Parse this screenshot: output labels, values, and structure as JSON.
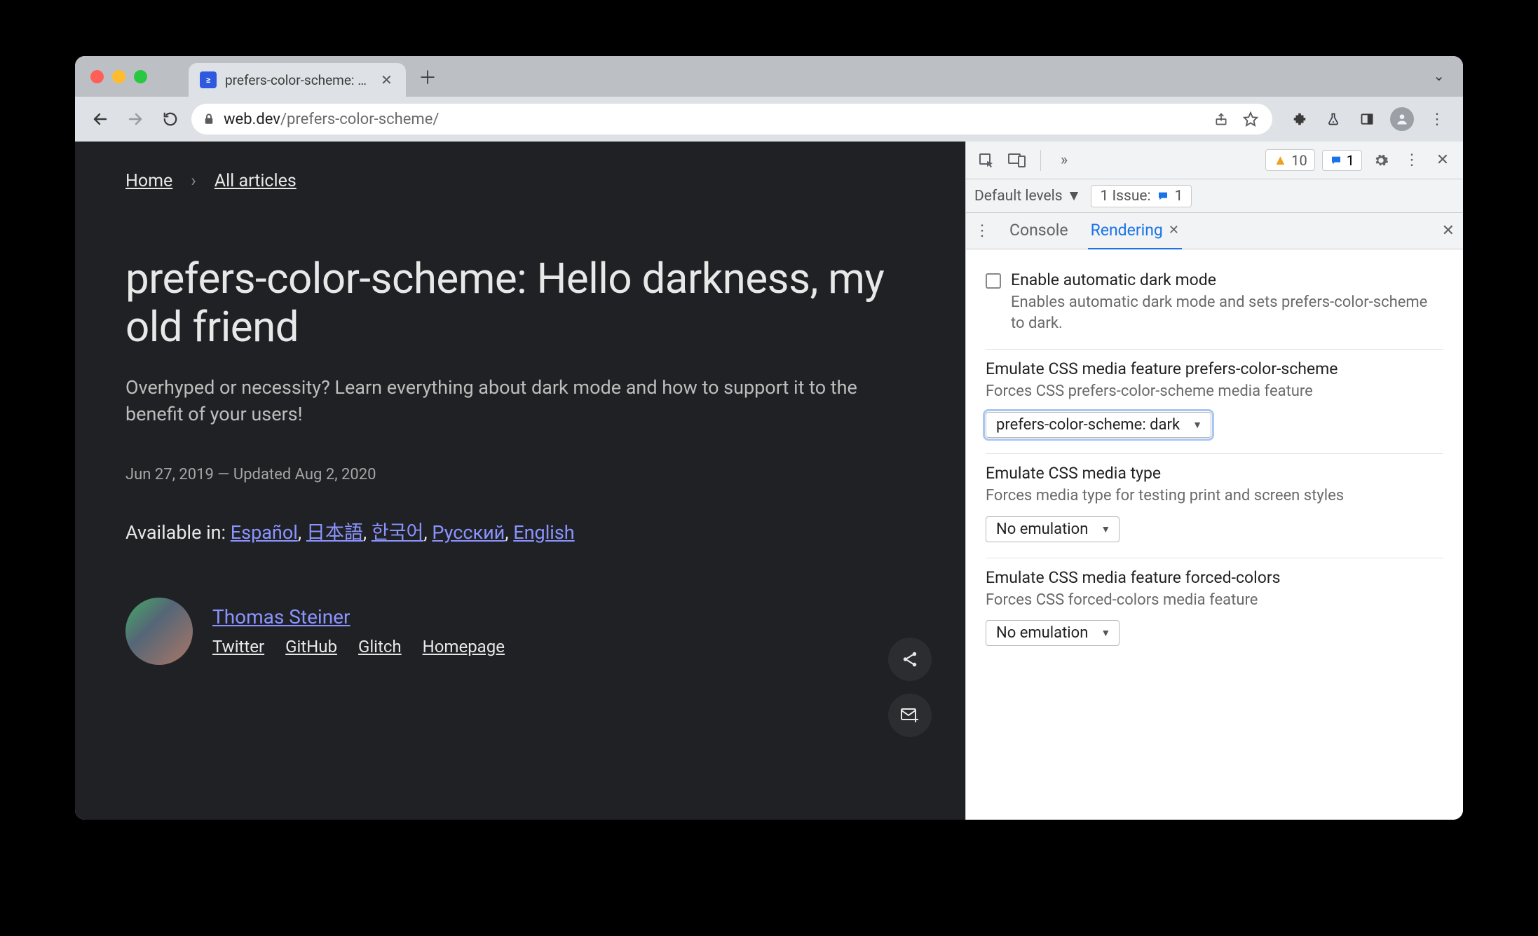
{
  "tab": {
    "title": "prefers-color-scheme: Hello da"
  },
  "url": {
    "domain": "web.dev",
    "path": "/prefers-color-scheme/"
  },
  "breadcrumb": {
    "home": "Home",
    "all": "All articles"
  },
  "article": {
    "title": "prefers-color-scheme: Hello darkness, my old friend",
    "subtitle": "Overhyped or necessity? Learn everything about dark mode and how to support it to the benefit of your users!",
    "dates": "Jun 27, 2019 — Updated Aug 2, 2020",
    "available_label": "Available in: ",
    "langs": [
      "Español",
      "日本語",
      "한국어",
      "Русский",
      "English"
    ],
    "author": {
      "name": "Thomas Steiner",
      "links": [
        "Twitter",
        "GitHub",
        "Glitch",
        "Homepage"
      ]
    }
  },
  "devtools": {
    "warnings": "10",
    "messages": "1",
    "levels": "Default levels",
    "issue_label": "1 Issue:",
    "issue_count": "1",
    "tabs": {
      "console": "Console",
      "rendering": "Rendering"
    },
    "options": {
      "darkmode": {
        "title": "Enable automatic dark mode",
        "desc": "Enables automatic dark mode and sets prefers-color-scheme to dark."
      },
      "prefers": {
        "title": "Emulate CSS media feature prefers-color-scheme",
        "desc": "Forces CSS prefers-color-scheme media feature",
        "value": "prefers-color-scheme: dark"
      },
      "mediatype": {
        "title": "Emulate CSS media type",
        "desc": "Forces media type for testing print and screen styles",
        "value": "No emulation"
      },
      "forced": {
        "title": "Emulate CSS media feature forced-colors",
        "desc": "Forces CSS forced-colors media feature",
        "value": "No emulation"
      }
    }
  }
}
